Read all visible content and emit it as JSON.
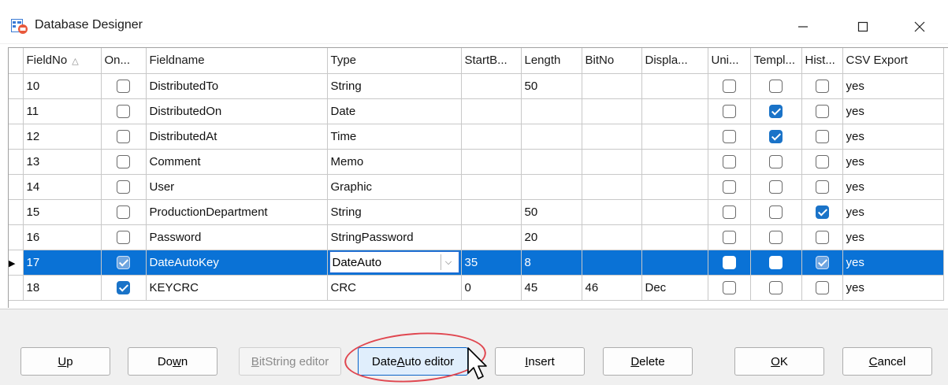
{
  "window": {
    "title": "Database Designer",
    "controls": {
      "minimize": "minimize",
      "maximize": "maximize",
      "close": "close"
    }
  },
  "grid": {
    "columns": [
      "FieldNo",
      "On...",
      "Fieldname",
      "Type",
      "StartB...",
      "Length",
      "BitNo",
      "Displa...",
      "Uni...",
      "Templ...",
      "Hist...",
      "CSV Export"
    ],
    "rows": [
      {
        "fieldno": "10",
        "on": false,
        "fieldname": "DistributedTo",
        "type": "String",
        "startb": "",
        "length": "50",
        "bitno": "",
        "display": "",
        "uni": false,
        "templ": false,
        "hist": false,
        "csv": "yes"
      },
      {
        "fieldno": "11",
        "on": false,
        "fieldname": "DistributedOn",
        "type": "Date",
        "startb": "",
        "length": "",
        "bitno": "",
        "display": "",
        "uni": false,
        "templ": true,
        "hist": false,
        "csv": "yes"
      },
      {
        "fieldno": "12",
        "on": false,
        "fieldname": "DistributedAt",
        "type": "Time",
        "startb": "",
        "length": "",
        "bitno": "",
        "display": "",
        "uni": false,
        "templ": true,
        "hist": false,
        "csv": "yes"
      },
      {
        "fieldno": "13",
        "on": false,
        "fieldname": "Comment",
        "type": "Memo",
        "startb": "",
        "length": "",
        "bitno": "",
        "display": "",
        "uni": false,
        "templ": false,
        "hist": false,
        "csv": "yes"
      },
      {
        "fieldno": "14",
        "on": false,
        "fieldname": "User",
        "type": "Graphic",
        "startb": "",
        "length": "",
        "bitno": "",
        "display": "",
        "uni": false,
        "templ": false,
        "hist": false,
        "csv": "yes"
      },
      {
        "fieldno": "15",
        "on": false,
        "fieldname": "ProductionDepartment",
        "type": "String",
        "startb": "",
        "length": "50",
        "bitno": "",
        "display": "",
        "uni": false,
        "templ": false,
        "hist": true,
        "csv": "yes"
      },
      {
        "fieldno": "16",
        "on": false,
        "fieldname": "Password",
        "type": "StringPassword",
        "startb": "",
        "length": "20",
        "bitno": "",
        "display": "",
        "uni": false,
        "templ": false,
        "hist": false,
        "csv": "yes"
      },
      {
        "fieldno": "17",
        "on": true,
        "fieldname": "DateAutoKey",
        "type": "DateAuto",
        "startb": "35",
        "length": "8",
        "bitno": "",
        "display": "",
        "uni": false,
        "templ": false,
        "hist": true,
        "csv": "yes",
        "selected": true
      },
      {
        "fieldno": "18",
        "on": true,
        "fieldname": "KEYCRC",
        "type": "CRC",
        "startb": "0",
        "length": "45",
        "bitno": "46",
        "display": "Dec",
        "uni": false,
        "templ": false,
        "hist": false,
        "csv": "yes"
      }
    ]
  },
  "buttons": {
    "up": {
      "pre": "",
      "u": "U",
      "post": "p"
    },
    "down": {
      "pre": "Do",
      "u": "w",
      "post": "n"
    },
    "bitstring": {
      "pre": "",
      "u": "B",
      "post": "itString editor"
    },
    "dateauto": {
      "pre": "Date",
      "u": "A",
      "post": "uto editor"
    },
    "insert": {
      "pre": "",
      "u": "I",
      "post": "nsert"
    },
    "delete": {
      "pre": "",
      "u": "D",
      "post": "elete"
    },
    "ok": {
      "pre": "",
      "u": "O",
      "post": "K"
    },
    "cancel": {
      "pre": "",
      "u": "C",
      "post": "ancel"
    }
  },
  "colors": {
    "selection": "#0a72d6",
    "checked": "#1a73c8",
    "annotation": "#e0464f"
  }
}
